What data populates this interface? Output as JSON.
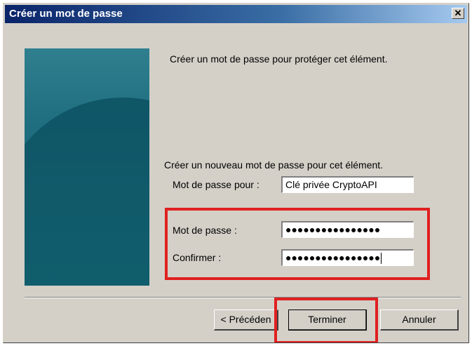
{
  "window": {
    "title": "Créer un mot de passe",
    "close_glyph": "✕"
  },
  "content": {
    "intro": "Créer un mot de passe pour protéger cet élément.",
    "sub_intro": "Créer un nouveau mot de passe pour cet élément.",
    "for_label": "Mot de passe pour :",
    "for_value": "Clé privée CryptoAPI",
    "password_label": "Mot de passe :",
    "password_mask": "●●●●●●●●●●●●●●●●",
    "confirm_label": "Confirmer :",
    "confirm_mask": "●●●●●●●●●●●●●●●●"
  },
  "buttons": {
    "back": "< Précéden",
    "finish": "Terminer",
    "cancel": "Annuler"
  },
  "colors": {
    "highlight": "#e02020",
    "titlebar": "#0a246a",
    "dialog_bg": "#d4d0c8",
    "side_image": "#1f6f80"
  }
}
